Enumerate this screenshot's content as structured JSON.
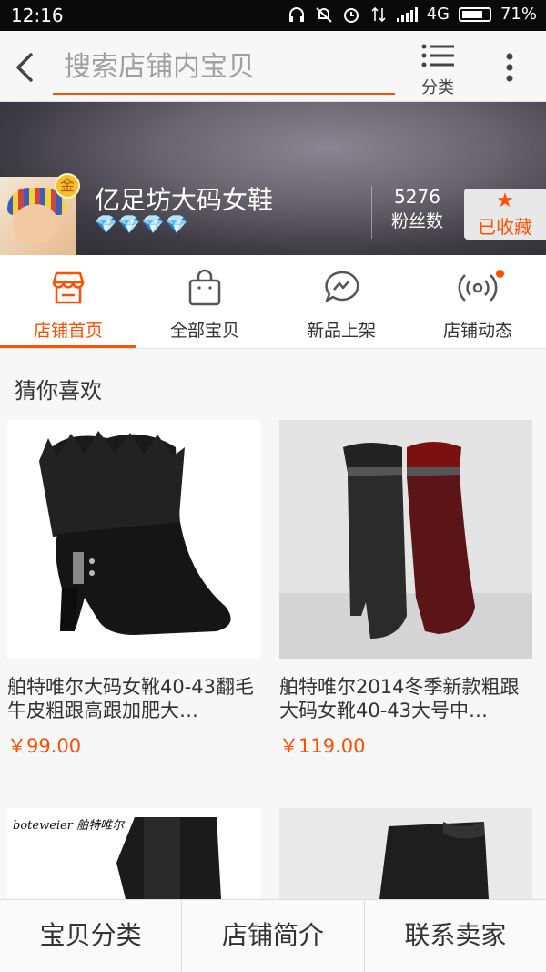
{
  "status_bar": {
    "time": "12:16",
    "network": "4G",
    "battery": "71%"
  },
  "header": {
    "search_placeholder": "搜索店铺内宝贝",
    "category_label": "分类"
  },
  "shop": {
    "badge": "金",
    "name": "亿足坊大码女鞋",
    "diamonds": "💎💎💎💎",
    "fans_count": "5276",
    "fans_label": "粉丝数",
    "collect_label": "已收藏"
  },
  "tabs": [
    {
      "label": "店铺首页",
      "icon": "storefront-icon",
      "active": true
    },
    {
      "label": "全部宝贝",
      "icon": "shopping-bag-icon",
      "active": false
    },
    {
      "label": "新品上架",
      "icon": "new-arrival-icon",
      "active": false
    },
    {
      "label": "店铺动态",
      "icon": "broadcast-icon",
      "active": false
    }
  ],
  "section": {
    "title": "猜你喜欢"
  },
  "products": [
    {
      "title": "舶特唯尔大码女靴40-43翻毛牛皮粗跟高跟加肥大…",
      "price": "￥99.00"
    },
    {
      "title": "舶特唯尔2014冬季新款粗跟大码女靴40-43大号中…",
      "price": "￥119.00"
    },
    {
      "brand": "boteweier 舶特唯尔"
    },
    {}
  ],
  "bottom_bar": {
    "category": "宝贝分类",
    "intro": "店铺简介",
    "contact": "联系卖家"
  },
  "colors": {
    "accent": "#ff5000"
  }
}
